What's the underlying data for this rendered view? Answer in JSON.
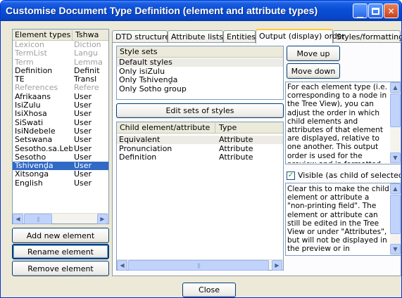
{
  "window": {
    "title": "Customise Document Type Definition (element and attribute types)"
  },
  "element_list": {
    "columns": [
      "Element types",
      "Tshwa"
    ],
    "rows": [
      {
        "name": "Lexicon",
        "type": "Diction",
        "greyed": true,
        "selected": false
      },
      {
        "name": "TermList",
        "type": "Langu",
        "greyed": true,
        "selected": false
      },
      {
        "name": "Term",
        "type": "Lemma",
        "greyed": true,
        "selected": false
      },
      {
        "name": "Definition",
        "type": "Definit",
        "greyed": false,
        "selected": false
      },
      {
        "name": "TE",
        "type": "Transl",
        "greyed": false,
        "selected": false
      },
      {
        "name": "References",
        "type": "Refere",
        "greyed": true,
        "selected": false
      },
      {
        "name": "Afrikaans",
        "type": "User",
        "greyed": false,
        "selected": false
      },
      {
        "name": "IsiZulu",
        "type": "User",
        "greyed": false,
        "selected": false
      },
      {
        "name": "IsiXhosa",
        "type": "User",
        "greyed": false,
        "selected": false
      },
      {
        "name": "SiSwati",
        "type": "User",
        "greyed": false,
        "selected": false
      },
      {
        "name": "IsiNdebele",
        "type": "User",
        "greyed": false,
        "selected": false
      },
      {
        "name": "Setswana",
        "type": "User",
        "greyed": false,
        "selected": false
      },
      {
        "name": "Sesotho.sa.Leboa",
        "type": "User",
        "greyed": false,
        "selected": false
      },
      {
        "name": "Sesotho",
        "type": "User",
        "greyed": false,
        "selected": false
      },
      {
        "name": "Tshivenḓa",
        "type": "User",
        "greyed": false,
        "selected": true
      },
      {
        "name": "Xitsonga",
        "type": "User",
        "greyed": false,
        "selected": false
      },
      {
        "name": "English",
        "type": "User",
        "greyed": false,
        "selected": false
      }
    ]
  },
  "buttons": {
    "add": "Add new element",
    "rename": "Rename element",
    "remove": "Remove element",
    "close": "Close",
    "move_up": "Move up",
    "move_down": "Move down",
    "edit_sets": "Edit sets of styles"
  },
  "tabs": [
    "DTD structure",
    "Attribute lists",
    "Entities",
    "Output (display) order",
    "Styles/formatting"
  ],
  "active_tab": "Output (display) order",
  "style_sets": {
    "header": "Style sets",
    "items": [
      "Default styles",
      "Only isiZulu",
      "Only Tshivenḓa",
      "Only Sotho group"
    ]
  },
  "children_grid": {
    "columns": [
      "Child element/attribute",
      "Type"
    ],
    "rows": [
      {
        "name": "Equivalent",
        "type": "Attribute"
      },
      {
        "name": "Pronunciation",
        "type": "Attribute"
      },
      {
        "name": "Definition",
        "type": "Attribute"
      }
    ]
  },
  "help_text_1": "For each element type (i.e. corresponding to a node in the Tree View), you can adjust the order in which child elements and attributes of that element are displayed, relative to one another. This output order is used for the preview and in formatted output such as RTF.",
  "visible_checkbox": {
    "label": "Visible (as child of selected eler",
    "checked": true
  },
  "help_text_2": "Clear this to make the child element or attribute a \"non-printing field\". The element or attribute can still be edited in the Tree View or under \"Attributes\", but will not be displayed in the preview or in",
  "colors": {
    "selection": "#316ac5",
    "title_bar": "#0a4fd8",
    "dialog_bg": "#ece9d8"
  }
}
